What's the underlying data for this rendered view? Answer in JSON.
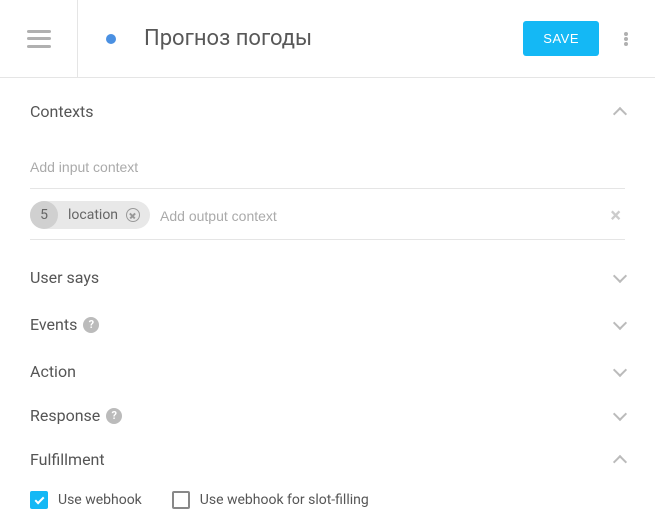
{
  "header": {
    "title": "Прогноз погоды",
    "save_label": "SAVE"
  },
  "sections": {
    "contexts": {
      "title": "Contexts",
      "input_placeholder": "Add input context",
      "output_placeholder": "Add output context",
      "output_chips": [
        {
          "count": "5",
          "label": "location"
        }
      ]
    },
    "user_says": {
      "title": "User says"
    },
    "events": {
      "title": "Events"
    },
    "action": {
      "title": "Action"
    },
    "response": {
      "title": "Response"
    },
    "fulfillment": {
      "title": "Fulfillment",
      "use_webhook_label": "Use webhook",
      "use_webhook_checked": true,
      "slot_filling_label": "Use webhook for slot-filling",
      "slot_filling_checked": false
    }
  }
}
